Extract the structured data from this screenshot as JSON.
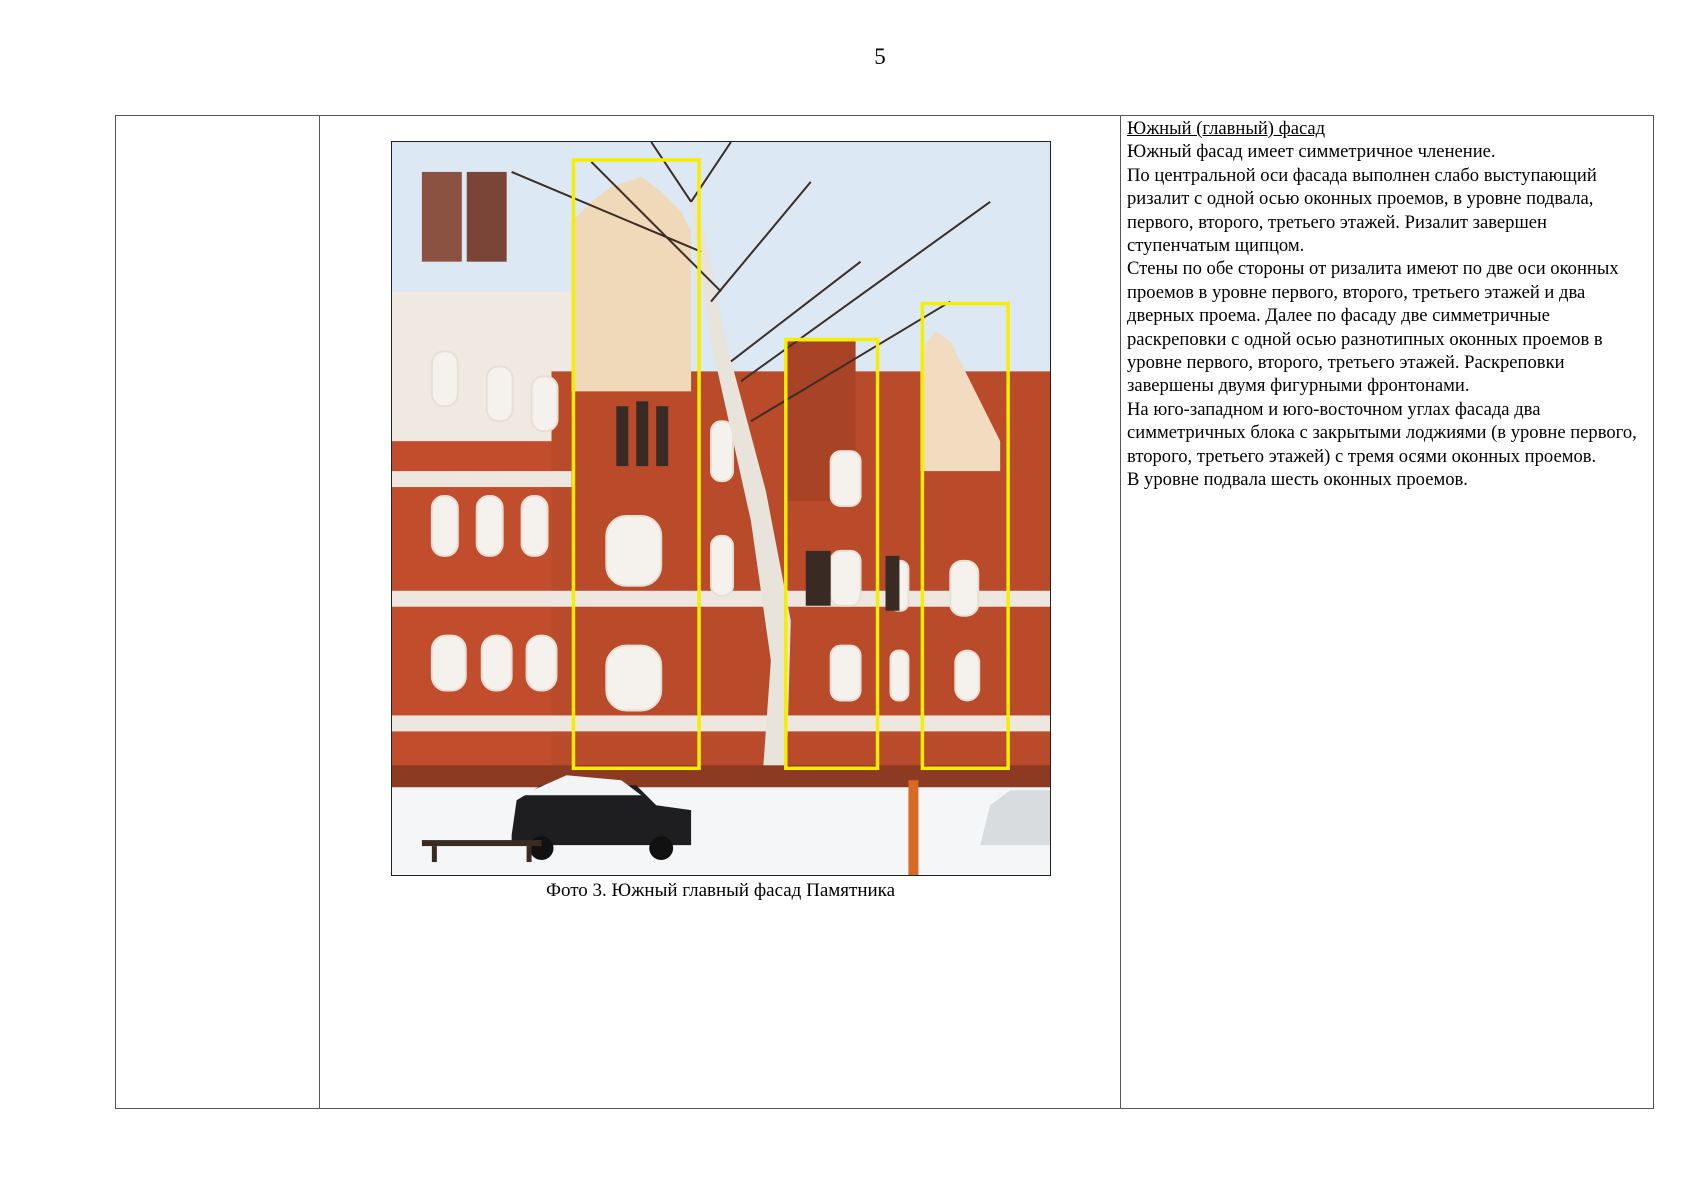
{
  "page": {
    "number": "5"
  },
  "photo": {
    "caption": "Фото 3. Южный главный фасад Памятника",
    "highlight_color": "#f5ee00",
    "highlights": 3
  },
  "description": {
    "heading": "Южный (главный) фасад",
    "paragraphs": [
      "Южный фасад имеет симметричное членение.",
      "По центральной оси фасада выполнен слабо выступающий ризалит с одной осью оконных проемов, в уровне подвала, первого, второго, третьего этажей. Ризалит завершен ступенчатым щипцом.",
      "Стены по обе стороны от ризалита имеют по две оси оконных проемов в уровне первого, второго, третьего этажей и два дверных проема. Далее по фасаду две симметричные раскреповки с одной осью разнотипных оконных проемов в уровне первого, второго, третьего этажей. Раскреповки завершены двумя фигурными фронтонами.",
      "На юго-западном и юго-восточном углах фасада два симметричных блока с закрытыми лоджиями (в уровне первого, второго, третьего этажей) с тремя осями оконных проемов.",
      "В уровне подвала шесть оконных проемов."
    ]
  }
}
